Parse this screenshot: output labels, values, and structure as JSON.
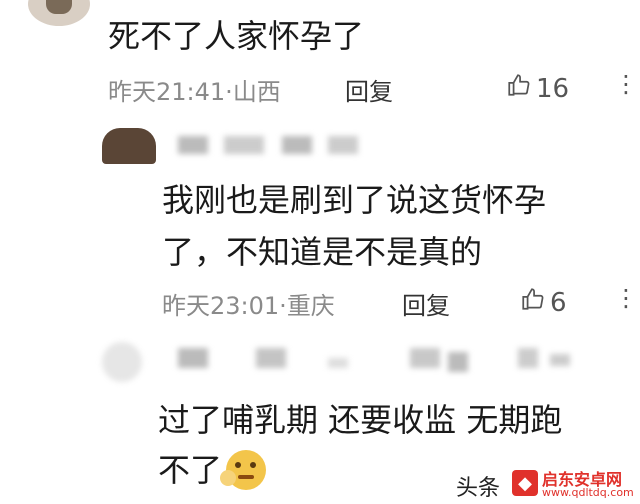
{
  "comments": [
    {
      "text": "死不了人家怀孕了",
      "time": "昨天21:41",
      "location": "山西",
      "reply_label": "回复",
      "likes": "16"
    },
    {
      "line1": "我刚也是刷到了说这货怀孕",
      "line2": "了，不知道是不是真的",
      "time": "昨天23:01",
      "location": "重庆",
      "reply_label": "回复",
      "likes": "6"
    },
    {
      "line1": "过了哺乳期 还要收监 无期跑",
      "line2": "不了"
    }
  ],
  "meta_separator": "·",
  "watermark": {
    "left_text": "头条",
    "brand": "启东安卓网",
    "url": "www.qdltdq.com"
  },
  "colors": {
    "meta": "#8a8a8a",
    "text": "#1a1a1a",
    "brand": "#e0312b"
  },
  "icons": [
    "thumbs-up-icon",
    "more-icon",
    "emoji-icon"
  ]
}
